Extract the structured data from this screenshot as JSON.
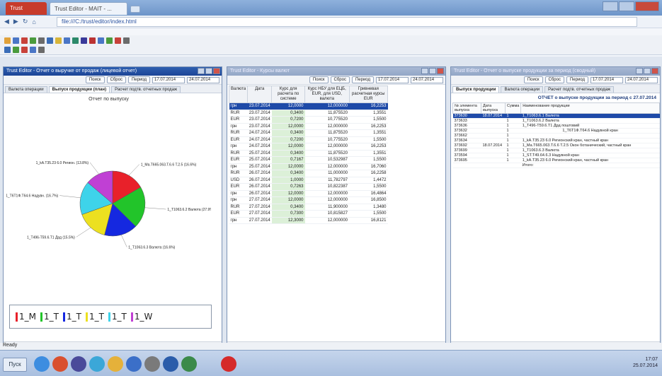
{
  "browser": {
    "tab1_label": "Trust",
    "tab2_label": "Trust Editor - MAIT - ...",
    "address": "file:///C:/trust/editor/index.html"
  },
  "app": {
    "status": "Ready"
  },
  "windows": {
    "left": {
      "title": "Trust Editor - Отчет о выручке от продаж (лицевой отчет)",
      "btn_clear": "Поиск",
      "btn_open": "Сброс",
      "btn_period": "Период",
      "date_from": "17.07.2014",
      "date_to": "24.07.2014",
      "tabs": [
        "Валюта операции",
        "Выпуск продукции (план)",
        "Расчет подтв. отчетных продаж"
      ],
      "chart_title": "Отчет по выпуску"
    },
    "middle": {
      "title": "Trust Editor - Курсы валют",
      "btn_clear": "Поиск",
      "btn_open": "Сброс",
      "btn_period": "Период",
      "date_from": "17.07.2014",
      "date_to": "24.07.2014",
      "columns": [
        "Валюта",
        "Дата",
        "Курс для расчета по системе",
        "Курс НБУ для ЕЦБ, EUR, для USD, валюта",
        "Гривневая расчетная курсы EUR"
      ],
      "rows": [
        [
          "грн",
          "23.07.2014",
          "12,0000",
          "12,000000",
          "16,2253"
        ],
        [
          "RUR",
          "23.07.2014",
          "0,3400",
          "11,875520",
          "1,3551"
        ],
        [
          "EUR",
          "23.07.2014",
          "0,7200",
          "10,775520",
          "1,5500"
        ],
        [
          "грн",
          "23.07.2014",
          "12,0000",
          "12,000000",
          "16,2253"
        ],
        [
          "RUR",
          "24.07.2014",
          "0,3400",
          "11,875520",
          "1,3551"
        ],
        [
          "EUR",
          "24.07.2014",
          "0,7200",
          "10,775520",
          "1,5500"
        ],
        [
          "грн",
          "24.07.2014",
          "12,0000",
          "12,000000",
          "16,2253"
        ],
        [
          "RUR",
          "25.07.2014",
          "0,3400",
          "11,875520",
          "1,3551"
        ],
        [
          "EUR",
          "25.07.2014",
          "0,7167",
          "10,532987",
          "1,5500"
        ],
        [
          "грн",
          "25.07.2014",
          "12,0000",
          "12,000000",
          "16,7060"
        ],
        [
          "RUR",
          "26.07.2014",
          "0,3400",
          "11,000000",
          "16,2258"
        ],
        [
          "USD",
          "26.07.2014",
          "1,0000",
          "11,782797",
          "1,4472"
        ],
        [
          "EUR",
          "26.07.2014",
          "0,7263",
          "10,822387",
          "1,5500"
        ],
        [
          "грн",
          "26.07.2014",
          "12,0000",
          "12,000000",
          "16,4864"
        ],
        [
          "грн",
          "27.07.2014",
          "12,0000",
          "12,000000",
          "16,8500"
        ],
        [
          "RUR",
          "27.07.2014",
          "0,3400",
          "11,900000",
          "1,3480"
        ],
        [
          "EUR",
          "27.07.2014",
          "0,7300",
          "10,815827",
          "1,5500"
        ],
        [
          "грн",
          "27.07.2014",
          "12,3000",
          "12,000000",
          "16,8121"
        ]
      ]
    },
    "right": {
      "title": "Trust Editor - Отчет о выпуске продукции за период (сводный)",
      "btn_clear": "Поиск",
      "btn_open": "Сброс",
      "btn_period": "Период",
      "date_from": "17.07.2014",
      "date_to": "24.07.2014",
      "tabs": [
        "Выпуск продукции",
        "Валюта операции",
        "Расчет подтв. отчетных продаж"
      ],
      "report_heading": "ОТЧЕТ о выпуске продукции за период с 27.07.2014",
      "col_num": "№ элемента выпуска",
      "col_date": "Дата выпуска",
      "col_qty": "Сумма",
      "col_name": "Наименование продукции",
      "rows": [
        [
          "373630",
          "18.07.2014",
          "1",
          "1_T1063.6.1 Валюта"
        ],
        [
          "373633",
          "",
          "1",
          "1_T1063.6.2 Валюта"
        ],
        [
          "373636",
          "",
          "1",
          "1_T496-T59.6.T1 Дрд поштовий"
        ],
        [
          "373632",
          "",
          "1",
          "1_T6T1Ф.T64.6 Надувной кран"
        ],
        [
          "373662",
          "",
          "1",
          ""
        ],
        [
          "373634",
          "",
          "1",
          "1_kA.T35.23 6.0 Регионский кран, частный кран"
        ],
        [
          "373692",
          "18.07.2014",
          "1",
          "1_Ma.T665.063.T.6.6 Т.2.5 Окон ботанический, частный кран"
        ],
        [
          "373699",
          "",
          "1",
          "1_T1063.6.3 Валюта"
        ],
        [
          "373594",
          "",
          "1",
          "1_ST.T49.64.6.3 Надувной кран"
        ],
        [
          "373695",
          "",
          "1",
          "1_kA.T35.23 6.0 Регионский кран, частный кран"
        ],
        [
          "",
          "",
          "",
          "Итого:"
        ]
      ]
    }
  },
  "chart_data": {
    "type": "pie",
    "title": "Отчет по выпуску",
    "slices": [
      {
        "label": "1_Ma.T665.063.T.6.6 Т.2.5 (16.6%)",
        "value": 16.6,
        "color": "#e8212a"
      },
      {
        "label": "1_T1063.6.2 Валюта (27.9%)",
        "value": 20.8,
        "color": "#22c42a"
      },
      {
        "label": "1_T1063.6.3 Валюта (16.6%)",
        "value": 16.6,
        "color": "#1528e0"
      },
      {
        "label": "1_T496-T59.6.T1 Дрд (15.5%)",
        "value": 15.5,
        "color": "#ece020"
      },
      {
        "label": "1_T6T1Ф.T64.6 Надувн. (16.7%)",
        "value": 16.7,
        "color": "#3ed3ea"
      },
      {
        "label": "1_kA.T35.23 6.0 Регион. (13.8%)",
        "value": 13.8,
        "color": "#c040d4"
      }
    ],
    "legend": [
      {
        "label": "1_M",
        "color": "#e8212a"
      },
      {
        "label": "1_T",
        "color": "#22c42a"
      },
      {
        "label": "1_T",
        "color": "#1528e0"
      },
      {
        "label": "1_T",
        "color": "#ece020"
      },
      {
        "label": "1_T",
        "color": "#3ed3ea"
      },
      {
        "label": "1_W",
        "color": "#c040d4"
      }
    ]
  },
  "taskbar": {
    "start_label": "Пуск",
    "clock_time": "17:07",
    "clock_date": "25.07.2014"
  }
}
